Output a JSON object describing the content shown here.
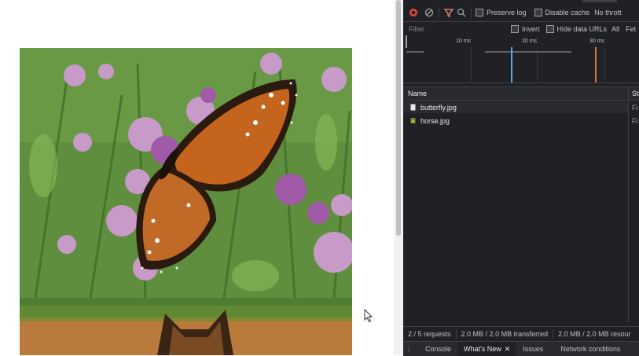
{
  "devtools": {
    "toolbar": {
      "preserve_log": "Preserve log",
      "disable_cache": "Disable cache",
      "throttle": "No thrott"
    },
    "filter": {
      "placeholder": "Filter",
      "invert": "Invert",
      "hide_data_urls": "Hide data URLs",
      "type_all": "All",
      "type_fetch": "Fet"
    },
    "overview": {
      "ticks": [
        "10 ms",
        "20 ms",
        "30 ms"
      ]
    },
    "columns": {
      "name": "Name",
      "status": "St"
    },
    "requests": [
      {
        "name": "butterfly.jpg",
        "status": "Fi"
      },
      {
        "name": "horse.jpg",
        "status": "Fi"
      }
    ],
    "summary": {
      "requests": "2 / 5 requests",
      "transferred": "2.0 MB / 2.0 MB transferred",
      "resources": "2.0 MB / 2.0 MB resour"
    },
    "drawer_tabs": {
      "console": "Console",
      "whats_new": "What's New",
      "issues": "Issues",
      "network_conditions": "Network conditions"
    }
  },
  "colors": {
    "devtools_bg": "#202124",
    "record_red": "#e8453c",
    "filter_icon": "#f28b82",
    "timeline_blue": "#5aa9e6",
    "timeline_red": "#e06c4f"
  },
  "icons": [
    "record-icon",
    "clear-icon",
    "filter-icon",
    "search-icon",
    "menu-icon",
    "close-icon",
    "mouse-cursor-icon"
  ]
}
